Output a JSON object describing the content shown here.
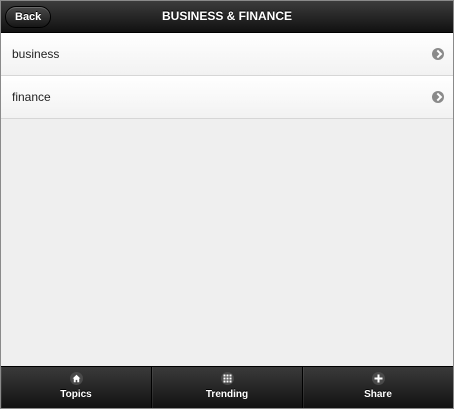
{
  "header": {
    "back_label": "Back",
    "title": "BUSINESS & FINANCE"
  },
  "list": {
    "items": [
      {
        "label": "business",
        "icon": "chevron-right-icon"
      },
      {
        "label": "finance",
        "icon": "chevron-right-icon"
      }
    ]
  },
  "footer": {
    "tabs": [
      {
        "label": "Topics",
        "icon": "home-icon"
      },
      {
        "label": "Trending",
        "icon": "grid-icon"
      },
      {
        "label": "Share",
        "icon": "plus-icon"
      }
    ]
  },
  "colors": {
    "bar_dark": "#111111",
    "background": "#efefef",
    "arrow": "#8a8a8a"
  }
}
